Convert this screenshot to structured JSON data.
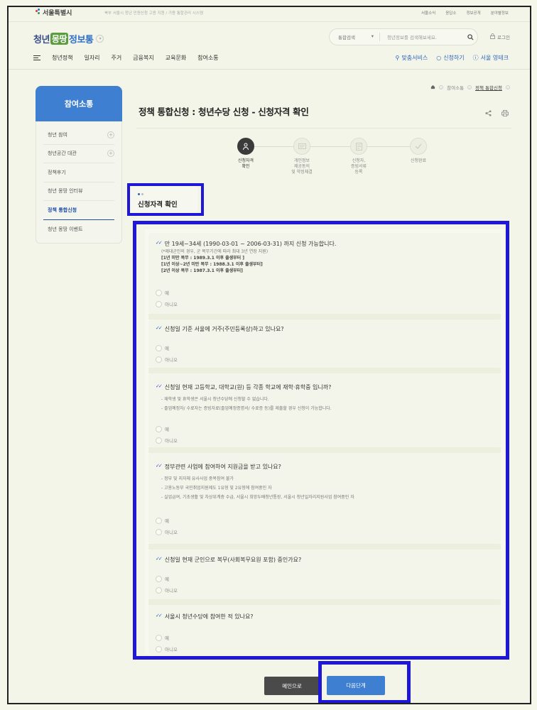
{
  "topbar": {
    "seoul_logo": "서울특별시",
    "notice": "북부 서울시 청년 민원신청 고용 지원 / 가용 통합관리 시스템",
    "util": [
      "서울소식",
      "응답소",
      "정보공개",
      "분야별정보"
    ]
  },
  "header": {
    "logo_part1": "청년",
    "logo_part2": "몽땅",
    "logo_part3": "정보통",
    "search_scope": "통합검색",
    "search_placeholder": "청년정보를 검색해보세요.",
    "login": "로그인"
  },
  "gnb": {
    "menus": [
      "청년정책",
      "일자리",
      "주거",
      "금융복지",
      "교육문화",
      "참여소통"
    ],
    "quick": [
      "맞춤서비스",
      "신청하기",
      "서울 영테크"
    ]
  },
  "lnb": {
    "title": "참여소통",
    "items": [
      {
        "label": "청년 참여",
        "expand": "+"
      },
      {
        "label": "청년공간 대관",
        "expand": "+"
      },
      {
        "label": "정책후기"
      },
      {
        "label": "청년 몽땅 인터뷰"
      },
      {
        "label": "정책 통합신청"
      },
      {
        "label": "청년 몽땅 이벤트"
      }
    ]
  },
  "breadcrumb": [
    "참여소통",
    "정책 통합신청"
  ],
  "page_title": "정책 통합신청 : 청년수당 신청 - 신청자격 확인",
  "steps": [
    {
      "line1": "신청자격",
      "line2": "확인"
    },
    {
      "line1": "개인정보",
      "line2": "제공동의",
      "line3": "및 약정체결"
    },
    {
      "line1": "신청자,",
      "line2": "증빙서류",
      "line3": "등록"
    },
    {
      "line1": "신청완료"
    }
  ],
  "section_title": "신청자격 확인",
  "questions": [
    {
      "title": "만 19세~34세 (1990-03-01 ~ 2006-03-31) 까지 신청 가능합니다.",
      "note": "(*제대군인의 경우, 군 복무기간에 따라 최대 3년 연장 지원)",
      "bold1": "[1년 미만 복무 : 1989.3.1 이후 출생부터 ]",
      "bold2": "[1년 이상~2년 미만 복무 : 1988.3.1 이후 출생부터]",
      "bold3": "[2년 이상 복무 : 1987.3.1 이후 출생부터]",
      "yes": "예",
      "no": "아니오"
    },
    {
      "title": "신청일 기준 서울에 거주(주민등록상)하고 있나요?",
      "yes": "예",
      "no": "아니오"
    },
    {
      "title": "신청일 현재 고등학교, 대학교(원) 등 각종 학교에 재학·휴학중 입니까?",
      "d1": "- 재학생 및 휴학생은 서울시 청년수당에 신청할 수 없습니다.",
      "d2": "- 졸업예정자/ 수료자는 증빙자료(졸업예정증명서/ 수료증 등)를 제출할 경우 신청이 가능합니다.",
      "yes": "예",
      "no": "아니오"
    },
    {
      "title": "정부관련 사업에 참여하여 지원금을 받고 있나요?",
      "d1": "- 정부 및 지자체 유사사업 중복참여 불가",
      "d2": "- 고용노동부 국민취업지원제도 1유형 및 2유형에 참여중인 자",
      "d3": "- 실업급여, 기초생활 및 차상위계층 수급, 서울시 희망두배청년통장, 서울시 청년일자리지원사업 참여중인 자",
      "yes": "예",
      "no": "아니오"
    },
    {
      "title": "신청일 현재 군인으로 복무(사회복무요원 포함) 중인가요?",
      "yes": "예",
      "no": "아니오"
    },
    {
      "title": "서울시 청년수당에 참여한 적 있나요?",
      "yes": "예",
      "no": "아니오"
    }
  ],
  "buttons": {
    "main": "메인으로",
    "next": "다음단계"
  },
  "colors": {
    "accent": "#3f7fd2",
    "highlight_box": "#1f17d8"
  }
}
